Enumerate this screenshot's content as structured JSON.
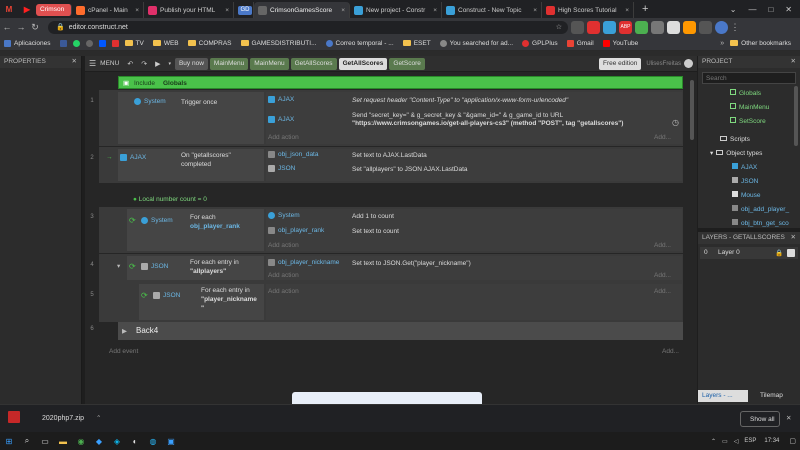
{
  "browser": {
    "pinned_tabs": [
      "M",
      "▶"
    ],
    "tabs": [
      {
        "label": "Crimson",
        "color": "#e05050"
      },
      {
        "label": "cPanel - Main",
        "color": "#ff6c2c"
      },
      {
        "label": "Publish your HTML",
        "color": "#e0306a"
      },
      {
        "label": "GD",
        "color": "#4a78c8"
      },
      {
        "label": "CrimsonGamesScore",
        "color": "#5a5a5a"
      },
      {
        "label": "New project - Constr",
        "color": "#3aa0d8"
      },
      {
        "label": "Construct - New Topic",
        "color": "#3aa0d8"
      },
      {
        "label": "High Scores Tutorial",
        "color": "#e03030"
      }
    ],
    "active_tab": "CrimsonGamesScore",
    "url": "editor.construct.net",
    "bookmarks": [
      "Aplicaciones",
      "TV",
      "WEB",
      "COMPRAS",
      "GAMESDISTRIBUTI...",
      "Correo temporal - ...",
      "ESET",
      "You searched for ad...",
      "GPLPlus",
      "Gmail",
      "YouTube"
    ],
    "other_bookmarks": "Other bookmarks"
  },
  "editor": {
    "properties_title": "PROPERTIES",
    "menu_label": "MENU",
    "buy_now": "Buy now",
    "tabs": [
      "MainMenu",
      "MainMenu",
      "GetAllScores",
      "GetAllScores",
      "GetScore"
    ],
    "active_tab_index": 3,
    "edition": "Free edition",
    "user": "UlisesFreitas",
    "include_label": "Include",
    "include_target": "Globals",
    "add_action": "Add action",
    "add_event": "Add event",
    "add_dots": "Add...",
    "events": {
      "e1": {
        "num": "1",
        "cond_obj": "System",
        "cond_text": "Trigger once",
        "a1_obj": "AJAX",
        "a1_text": "Set request header \"Content-Type\" to \"application/x-www-form-urlencoded\"",
        "a2_obj": "AJAX",
        "a2_line1": "Send \"secret_key=\" & g_secret_key & \"&game_id=\" & g_game_id to URL",
        "a2_line2": "\"https://www.crimsongames.io/get-all-players-cs3\" (method \"POST\", tag \"getallscores\")"
      },
      "e2": {
        "num": "2",
        "cond_obj": "AJAX",
        "cond_text1": "On \"getallscores\"",
        "cond_text2": "completed",
        "a1_obj": "obj_json_data",
        "a1_text": "Set text to AJAX.LastData",
        "a2_obj": "JSON",
        "a2_text": "Set \"allplayers\" to JSON AJAX.LastData"
      },
      "local_var": "Local number count = 0",
      "e3": {
        "num": "3",
        "cond_obj": "System",
        "cond_text1": "For each",
        "cond_text2": "obj_player_rank",
        "a1_obj": "System",
        "a1_text": "Add 1 to count",
        "a2_obj": "obj_player_rank",
        "a2_text": "Set text to count"
      },
      "e4": {
        "num": "4",
        "cond_obj": "JSON",
        "cond_text1": "For each entry in",
        "cond_text2": "\"allplayers\"",
        "a1_obj": "obj_player_nickname",
        "a1_text": "Set text to JSON.Get(\"player_nickname\")"
      },
      "e5": {
        "num": "5",
        "cond_obj": "JSON",
        "cond_text1": "For each entry in",
        "cond_text2": "\"player_nickname",
        "cond_text3": "\""
      },
      "e6": {
        "num": "6",
        "group": "Back4"
      }
    },
    "project": {
      "title": "PROJECT",
      "search_placeholder": "Search",
      "items": [
        "Globals",
        "MainMenu",
        "SetScore"
      ],
      "scripts": "Scripts",
      "object_types": "Object types",
      "objects": [
        "AJAX",
        "JSON",
        "Mouse",
        "obj_add_player_",
        "obj_btn_get_sco"
      ]
    },
    "layers": {
      "title": "LAYERS - GETALLSCORES",
      "layer_num": "0",
      "layer_name": "Layer 0",
      "bottom_tab1": "Layers - ...",
      "bottom_tab2": "Tilemap"
    }
  },
  "downloads": {
    "file": "2020php7.zip",
    "show_all": "Show all"
  },
  "taskbar": {
    "lang": "ESP",
    "time": "17:34"
  },
  "colors": {
    "accent_green": "#4ac24a",
    "object_blue": "#6cb8e6",
    "project_green": "#7fd97f"
  }
}
